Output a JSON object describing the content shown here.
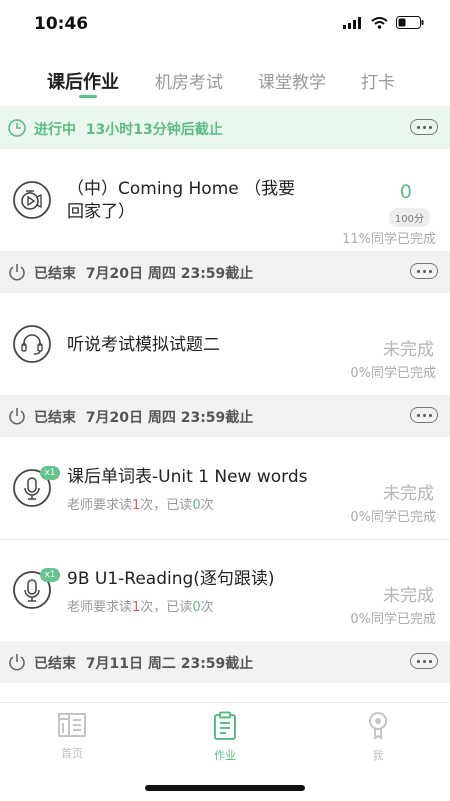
{
  "status_bar": {
    "time": "10:46"
  },
  "tabs": [
    {
      "label": "课后作业",
      "active": true
    },
    {
      "label": "机房考试"
    },
    {
      "label": "课堂教学"
    },
    {
      "label": "打卡"
    }
  ],
  "sections": [
    {
      "status": "进行中",
      "info": "13小时13分钟后截止",
      "color": "#5dbb83"
    },
    {
      "status": "已结束",
      "info": "7月20日 周四 23:59截止"
    },
    {
      "status": "已结束",
      "info": "7月20日 周四 23:59截止"
    },
    {
      "status": "已结束",
      "info": "7月11日 周二 23:59截止"
    }
  ],
  "assignments": [
    {
      "title_line1": "（中）Coming Home （我要",
      "title_line2": "回家了）",
      "score": "0",
      "total": "100分",
      "percent": "11%同学已完成",
      "icon": "video-play-icon"
    },
    {
      "title": "听说考试模拟试题二",
      "status": "未完成",
      "percent": "0%同学已完成",
      "icon": "headset-icon"
    },
    {
      "title": "课后单词表-Unit 1 New words",
      "badge": "x1",
      "req_prefix": "老师要求读",
      "req_num": "1",
      "req_mid": "次，已读",
      "read_num": "0",
      "req_suffix": "次",
      "status": "未完成",
      "percent": "0%同学已完成",
      "icon": "microphone-icon"
    },
    {
      "title": "9B U1-Reading(逐句跟读)",
      "badge": "x1",
      "req_prefix": "老师要求读",
      "req_num": "1",
      "req_mid": "次，已读",
      "read_num": "0",
      "req_suffix": "次",
      "status": "未完成",
      "percent": "0%同学已完成",
      "icon": "microphone-icon"
    }
  ],
  "bottom_nav": [
    {
      "label": "首页",
      "icon": "home-grid-icon"
    },
    {
      "label": "作业",
      "icon": "clipboard-icon",
      "active": true
    },
    {
      "label": "我",
      "icon": "profile-icon"
    }
  ]
}
